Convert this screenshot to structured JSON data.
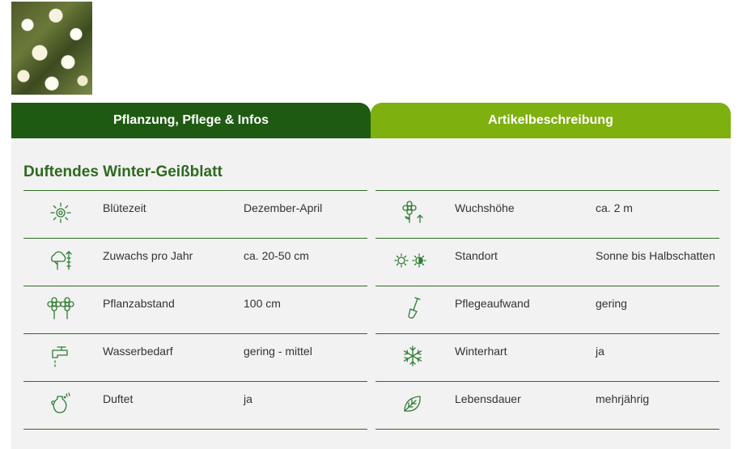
{
  "product_image": "honeysuckle-flowers-photo",
  "tabs": [
    {
      "label": "Pflanzung, Pflege & Infos",
      "active": true
    },
    {
      "label": "Artikelbeschreibung",
      "active": false
    }
  ],
  "product": {
    "title": "Duftendes Winter-Geißblatt"
  },
  "attributes_left": [
    {
      "icon": "flower-sun-icon",
      "label": "Blütezeit",
      "value": "Dezember-April"
    },
    {
      "icon": "tree-growth-icon",
      "label": "Zuwachs pro Jahr",
      "value": "ca. 20-50 cm"
    },
    {
      "icon": "flowers-spacing-icon",
      "label": "Pflanzabstand",
      "value": "100 cm"
    },
    {
      "icon": "water-tap-icon",
      "label": "Wasserbedarf",
      "value": "gering - mittel"
    },
    {
      "icon": "vase-scent-icon",
      "label": "Duftet",
      "value": "ja"
    }
  ],
  "attributes_right": [
    {
      "icon": "flower-height-icon",
      "label": "Wuchshöhe",
      "value": "ca. 2 m"
    },
    {
      "icon": "sun-partial-shade-icon",
      "label": "Standort",
      "value": "Sonne bis Halbschatten"
    },
    {
      "icon": "spade-icon",
      "label": "Pflegeaufwand",
      "value": "gering"
    },
    {
      "icon": "snowflake-icon",
      "label": "Winterhart",
      "value": "ja"
    },
    {
      "icon": "leaf-icon",
      "label": "Lebensdauer",
      "value": "mehrjährig"
    }
  ],
  "colors": {
    "dark_green": "#1f5a12",
    "light_green": "#7eb00f",
    "text_green": "#2d6a1f"
  }
}
